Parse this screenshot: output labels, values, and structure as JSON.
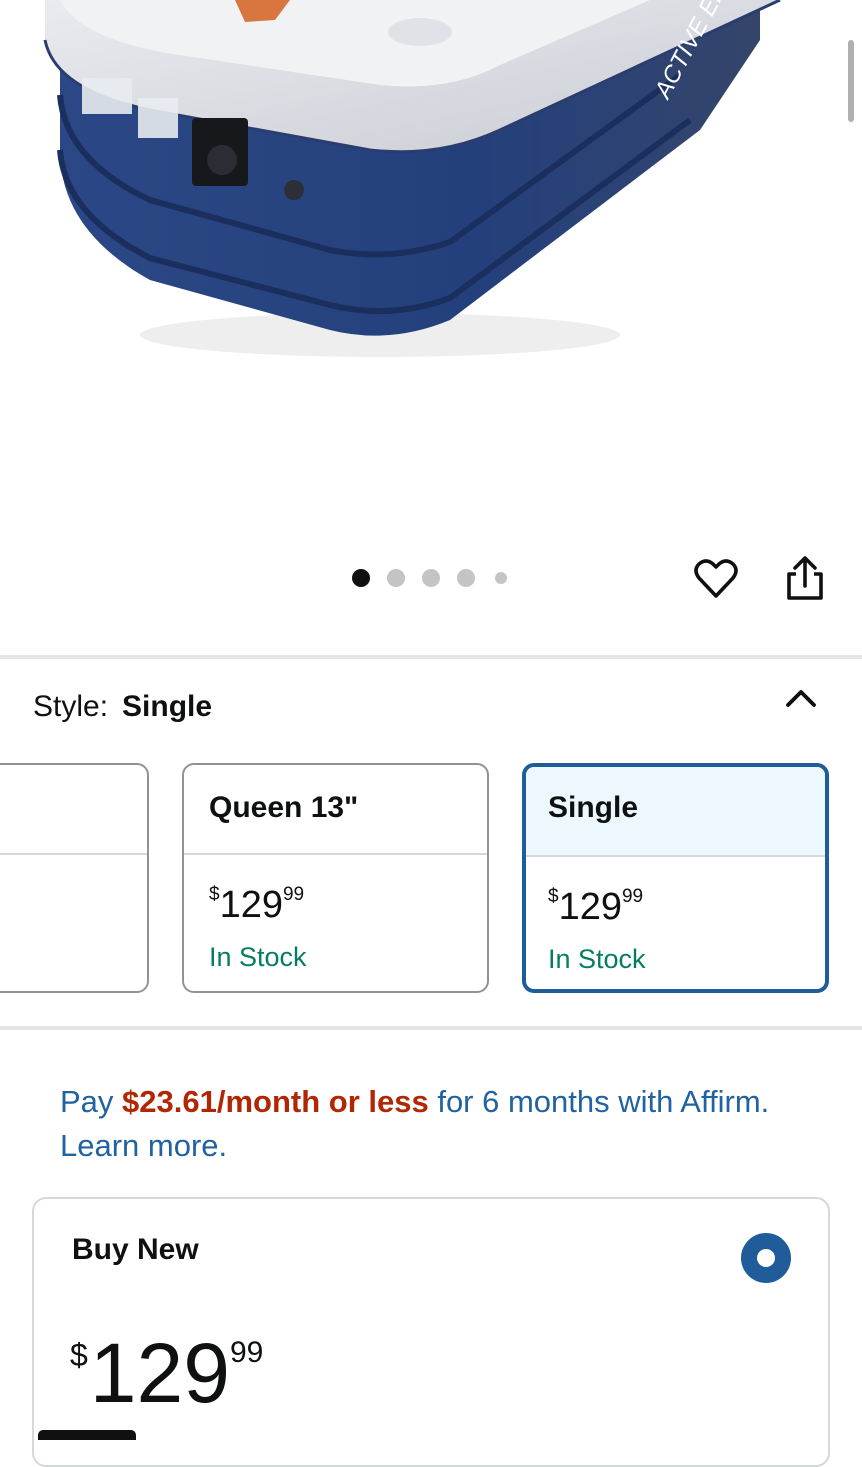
{
  "product_image": {
    "brand_text": "ACTIVE ERA",
    "carousel_dots": 5,
    "active_dot": 1
  },
  "actions": {
    "favorite_icon": "heart-outline-icon",
    "share_icon": "share-icon"
  },
  "style_selector": {
    "label": "Style:",
    "selected_value": "Single",
    "toggle_icon": "chevron-up-icon",
    "options": [
      {
        "name": "",
        "price_currency": "",
        "price_whole": "",
        "price_cents": "",
        "stock": ""
      },
      {
        "name": "Queen 13\"",
        "price_currency": "$",
        "price_whole": "129",
        "price_cents": "99",
        "stock": "In Stock"
      },
      {
        "name": "Single",
        "price_currency": "$",
        "price_whole": "129",
        "price_cents": "99",
        "stock": "In Stock",
        "selected": true
      }
    ]
  },
  "affirm": {
    "prefix": "Pay ",
    "highlight": "$23.61/month or less",
    "suffix": " for 6 months with Affirm. Learn more."
  },
  "buy_new": {
    "title": "Buy New",
    "price_currency": "$",
    "price_whole": "129",
    "price_cents": "99",
    "selected": true
  },
  "colors": {
    "accent_blue": "#1f5c99",
    "link_blue": "#2162a1",
    "price_red": "#b12704",
    "stock_green": "#067d62"
  }
}
